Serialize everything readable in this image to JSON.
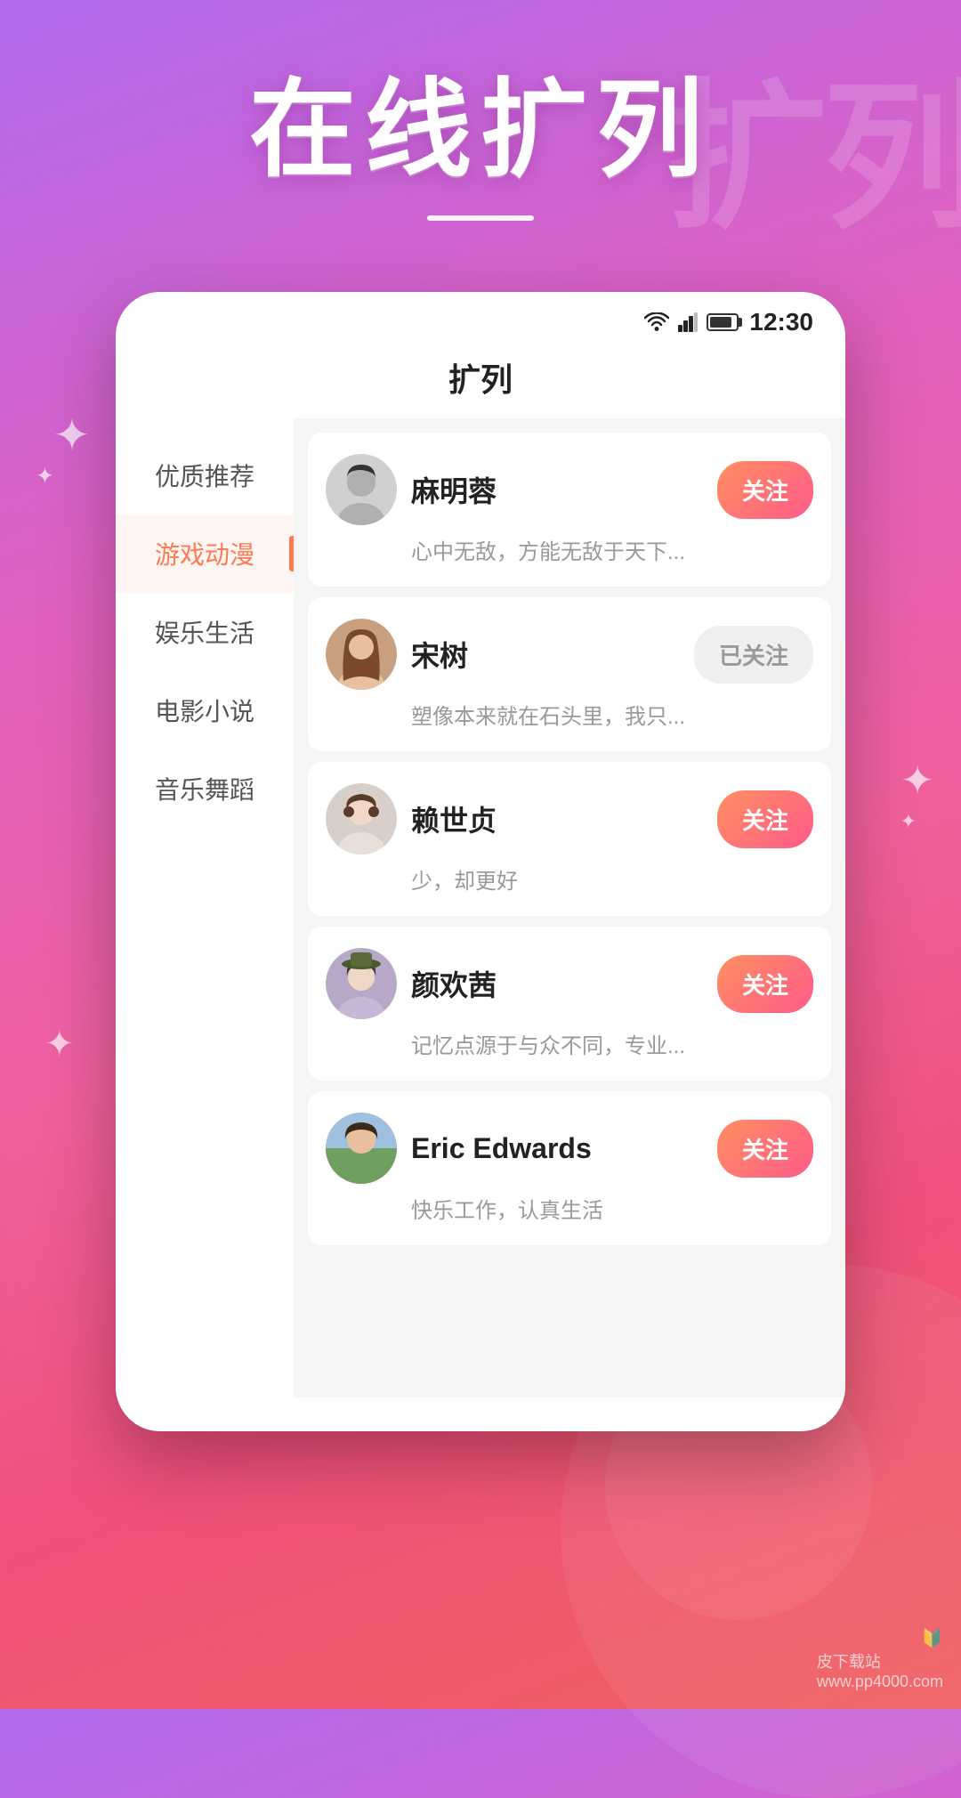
{
  "background": {
    "bgText": "扩列",
    "colors": {
      "gradientStart": "#b06aee",
      "gradientMid": "#e060c0",
      "gradientEnd": "#f06060"
    }
  },
  "header": {
    "title": "在线扩列",
    "divider": true
  },
  "statusBar": {
    "time": "12:30"
  },
  "appBar": {
    "title": "扩列"
  },
  "sidebar": {
    "items": [
      {
        "id": "recommend",
        "label": "优质推荐",
        "active": false
      },
      {
        "id": "game-anime",
        "label": "游戏动漫",
        "active": true
      },
      {
        "id": "entertainment",
        "label": "娱乐生活",
        "active": false
      },
      {
        "id": "movie-novel",
        "label": "电影小说",
        "active": false
      },
      {
        "id": "music-dance",
        "label": "音乐舞蹈",
        "active": false
      }
    ]
  },
  "users": [
    {
      "id": 1,
      "name": "麻明蓉",
      "bio": "心中无敌，方能无敌于天下...",
      "followed": false,
      "followLabel": "关注",
      "avatarType": "male-short"
    },
    {
      "id": 2,
      "name": "宋树",
      "bio": "塑像本来就在石头里，我只...",
      "followed": true,
      "followLabel": "已关注",
      "avatarType": "female-long"
    },
    {
      "id": 3,
      "name": "赖世贞",
      "bio": "少，却更好",
      "followed": false,
      "followLabel": "关注",
      "avatarType": "female-curly"
    },
    {
      "id": 4,
      "name": "颜欢茜",
      "bio": "记忆点源于与众不同，专业...",
      "followed": false,
      "followLabel": "关注",
      "avatarType": "female-hat"
    },
    {
      "id": 5,
      "name": "Eric Edwards",
      "bio": "快乐工作，认真生活",
      "followed": false,
      "followLabel": "关注",
      "avatarType": "female-outdoor"
    }
  ],
  "watermark": "皮下载站\nwww.pp4000.com"
}
